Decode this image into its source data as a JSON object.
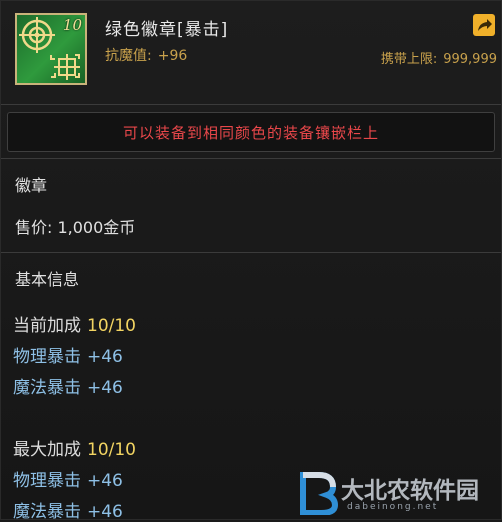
{
  "item": {
    "name": "绿色徽章[暴击]",
    "level_badge": "10",
    "stat_label": "抗魔值:",
    "stat_value": "+96",
    "carry_label": "携带上限:",
    "carry_value": "999,999"
  },
  "warning": "可以装备到相同颜色的装备镶嵌栏上",
  "category": "徽章",
  "price": "售价: 1,000金币",
  "basic_info_title": "基本信息",
  "current_bonus": {
    "label": "当前加成",
    "value": "10/10",
    "stats": [
      {
        "name": "物理暴击",
        "value": "+46"
      },
      {
        "name": "魔法暴击",
        "value": "+46"
      }
    ]
  },
  "max_bonus": {
    "label": "最大加成",
    "value": "10/10",
    "stats": [
      {
        "name": "物理暴击",
        "value": "+46"
      },
      {
        "name": "魔法暴击",
        "value": "+46"
      }
    ]
  },
  "watermark": {
    "text": "大北农软件园",
    "sub": "dabeinong.net"
  },
  "colors": {
    "accent_gold": "#c8a14c",
    "warning_red": "#e8474a",
    "stat_blue": "#8ec0e6",
    "value_yellow": "#f2d462",
    "icon_green": "#2f9a3d"
  },
  "icons": [
    "emblem-crosshair-icon",
    "share-icon",
    "watermark-logo-icon"
  ]
}
